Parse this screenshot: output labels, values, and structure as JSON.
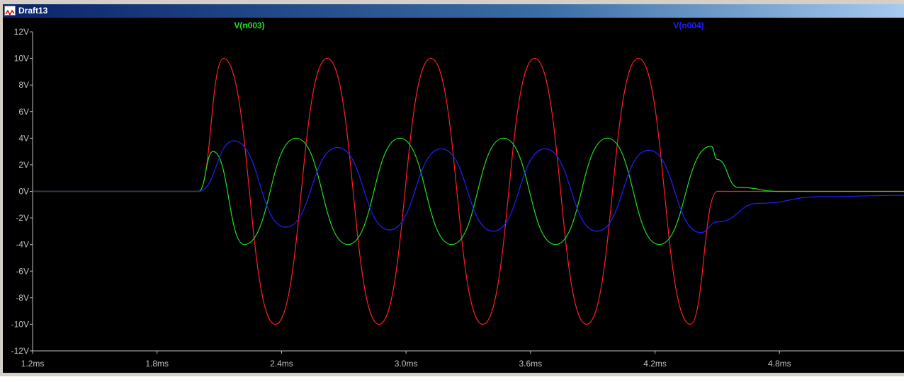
{
  "window": {
    "title": "Draft13",
    "icon": "waveform-icon"
  },
  "colors": {
    "trace_red": "#ff2020",
    "trace_green": "#20e020",
    "trace_blue": "#2020ff",
    "axis": "#c0c0c0",
    "background": "#000000"
  },
  "chart_data": {
    "type": "line",
    "x_unit": "ms",
    "y_unit": "V",
    "xlim": [
      1.2,
      5.4
    ],
    "ylim": [
      -12,
      12
    ],
    "x_ticks": [
      "1.2ms",
      "1.8ms",
      "2.4ms",
      "3.0ms",
      "3.6ms",
      "4.2ms",
      "4.8ms"
    ],
    "x_tick_values": [
      1.2,
      1.8,
      2.4,
      3.0,
      3.6,
      4.2,
      4.8
    ],
    "y_ticks": [
      "12V",
      "10V",
      "8V",
      "6V",
      "4V",
      "2V",
      "0V",
      "-2V",
      "-4V",
      "-6V",
      "-8V",
      "-10V",
      "-12V"
    ],
    "y_tick_values": [
      12,
      10,
      8,
      6,
      4,
      2,
      0,
      -2,
      -4,
      -6,
      -8,
      -10,
      -12
    ],
    "legend": [
      "V(n003)",
      "V(n004)"
    ],
    "grid": false,
    "series": [
      {
        "color": "#ff2020",
        "points": [
          [
            1.2,
            0
          ],
          [
            2.0,
            0
          ],
          [
            2.12,
            10
          ],
          [
            2.37,
            -10
          ],
          [
            2.62,
            10
          ],
          [
            2.87,
            -10
          ],
          [
            3.12,
            10
          ],
          [
            3.37,
            -10
          ],
          [
            3.62,
            10
          ],
          [
            3.87,
            -10
          ],
          [
            4.12,
            10
          ],
          [
            4.37,
            -10
          ],
          [
            4.5,
            0
          ],
          [
            5.4,
            0
          ]
        ]
      },
      {
        "name": "V(n003)",
        "color": "#20e020",
        "points": [
          [
            1.2,
            0
          ],
          [
            2.0,
            0
          ],
          [
            2.07,
            3
          ],
          [
            2.22,
            -4
          ],
          [
            2.47,
            4
          ],
          [
            2.72,
            -4
          ],
          [
            2.97,
            4
          ],
          [
            3.22,
            -4
          ],
          [
            3.47,
            4
          ],
          [
            3.72,
            -4
          ],
          [
            3.97,
            4
          ],
          [
            4.22,
            -4
          ],
          [
            4.47,
            3.4
          ],
          [
            4.5,
            2.4
          ],
          [
            4.6,
            0.3
          ],
          [
            4.8,
            0
          ],
          [
            5.4,
            0
          ]
        ]
      },
      {
        "name": "V(n004)",
        "color": "#2020ff",
        "points": [
          [
            1.2,
            0
          ],
          [
            2.0,
            0
          ],
          [
            2.17,
            3.8
          ],
          [
            2.42,
            -2.7
          ],
          [
            2.67,
            3.3
          ],
          [
            2.92,
            -2.9
          ],
          [
            3.17,
            3.2
          ],
          [
            3.42,
            -3
          ],
          [
            3.67,
            3.2
          ],
          [
            3.92,
            -3
          ],
          [
            4.17,
            3.1
          ],
          [
            4.42,
            -3.1
          ],
          [
            4.5,
            -2.3
          ],
          [
            4.7,
            -0.9
          ],
          [
            5.0,
            -0.4
          ],
          [
            5.4,
            -0.3
          ]
        ]
      }
    ]
  }
}
